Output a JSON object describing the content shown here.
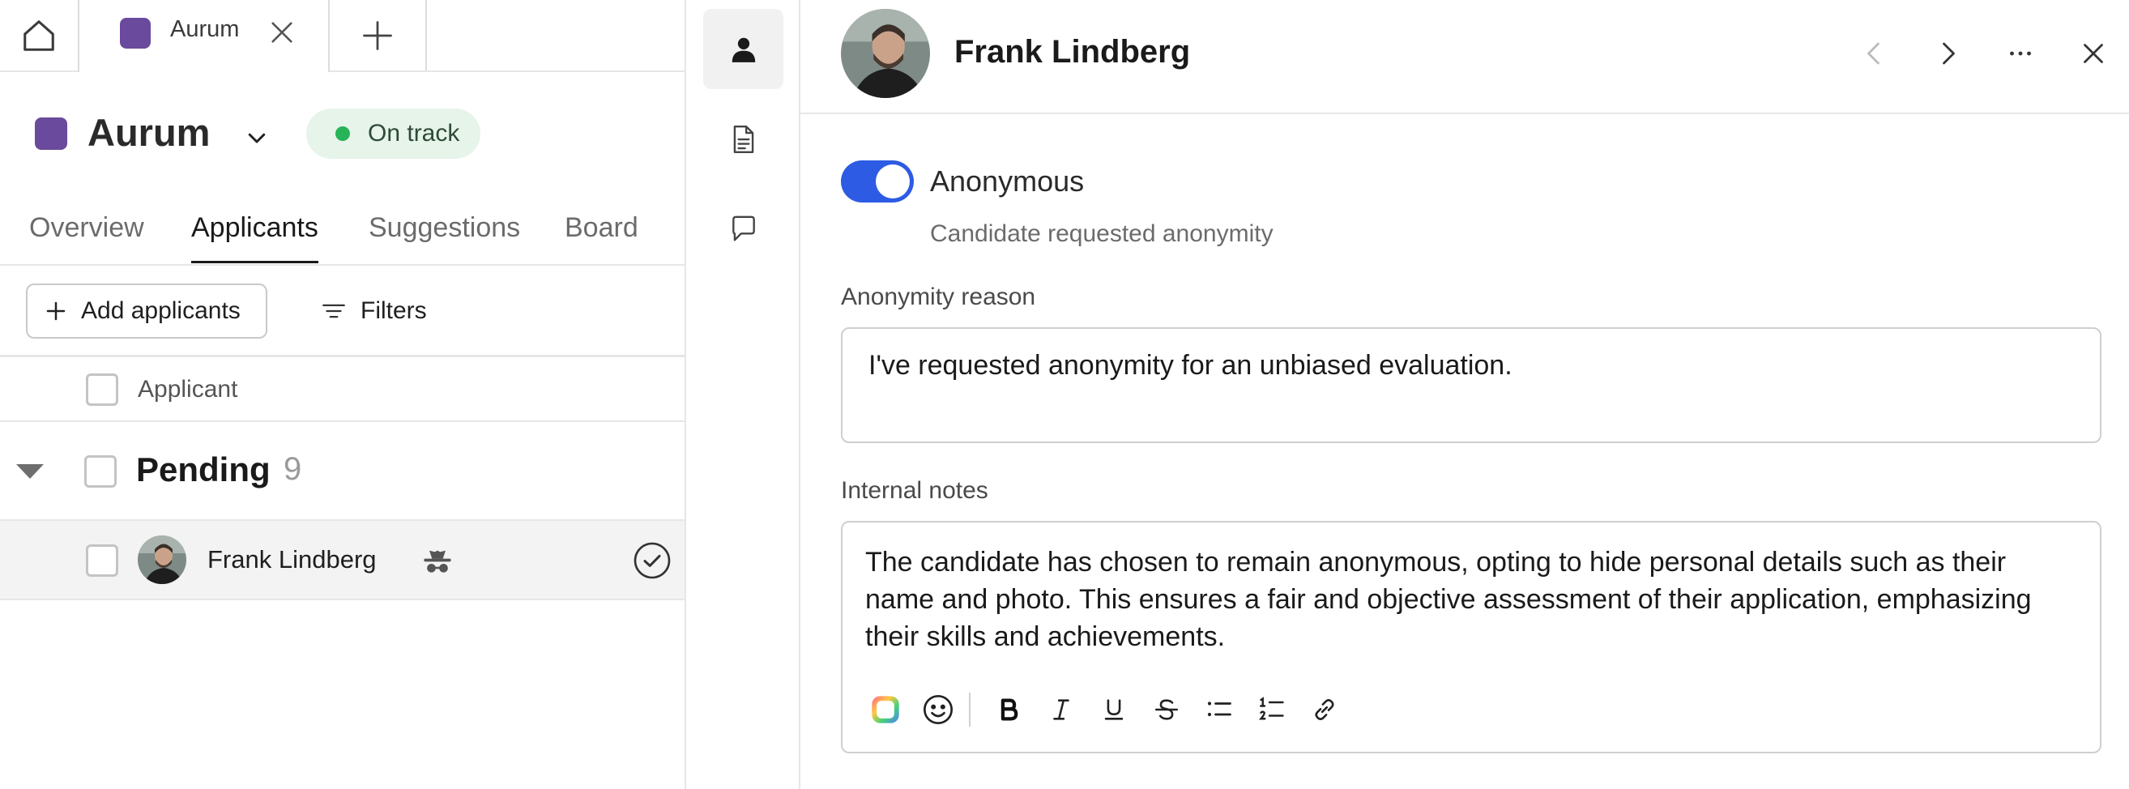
{
  "tabs": {
    "active_tab_label": "Aurum",
    "project_color": "#6a4a9c"
  },
  "project": {
    "name": "Aurum",
    "status": "On track",
    "status_color": "#27b358"
  },
  "nav": {
    "items": [
      {
        "label": "Overview"
      },
      {
        "label": "Applicants"
      },
      {
        "label": "Suggestions"
      },
      {
        "label": "Board"
      }
    ],
    "active": "Applicants"
  },
  "toolbar": {
    "add_label": "Add applicants",
    "filters_label": "Filters"
  },
  "table": {
    "column_header": "Applicant",
    "group": {
      "title": "Pending",
      "count": "9"
    },
    "rows": [
      {
        "name": "Frank Lindberg",
        "anonymous": true
      }
    ]
  },
  "detail": {
    "name": "Frank Lindberg",
    "toggle_label": "Anonymous",
    "toggle_on": true,
    "toggle_sub": "Candidate requested anonymity",
    "reason_label": "Anonymity reason",
    "reason_value": "I've requested anonymity for an unbiased evaluation.",
    "notes_label": "Internal notes",
    "notes_value": "The candidate has chosen to remain anonymous, opting to hide personal details such as their name and photo. This ensures a fair and objective assessment of their application, emphasizing their skills and achievements.",
    "accent_color": "#2d5be3"
  },
  "icons": {
    "home": "home-icon",
    "close_tab": "close-icon",
    "new_tab": "plus-icon",
    "rail": [
      "person-icon",
      "document-icon",
      "comment-icon"
    ],
    "header": [
      "chevron-left-icon",
      "chevron-right-icon",
      "more-icon",
      "close-icon"
    ],
    "format": [
      "color-icon",
      "emoji-icon",
      "bold-icon",
      "italic-icon",
      "underline-icon",
      "strikethrough-icon",
      "bullet-list-icon",
      "numbered-list-icon",
      "link-icon"
    ]
  }
}
